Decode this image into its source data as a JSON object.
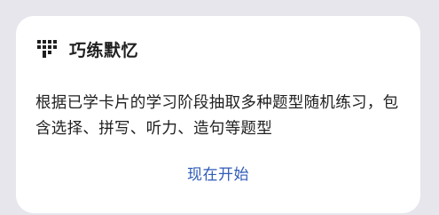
{
  "card": {
    "icon": "flashcard-practice-icon",
    "title": "巧练默忆",
    "description": "根据已学卡片的学习阶段抽取多种题型随机练习，包含选择、拼写、听力、造句等题型",
    "action_label": "现在开始"
  },
  "colors": {
    "background": "#e6e6ec",
    "card": "#ffffff",
    "text": "#1f1f1f",
    "accent": "#2f5bb7"
  }
}
